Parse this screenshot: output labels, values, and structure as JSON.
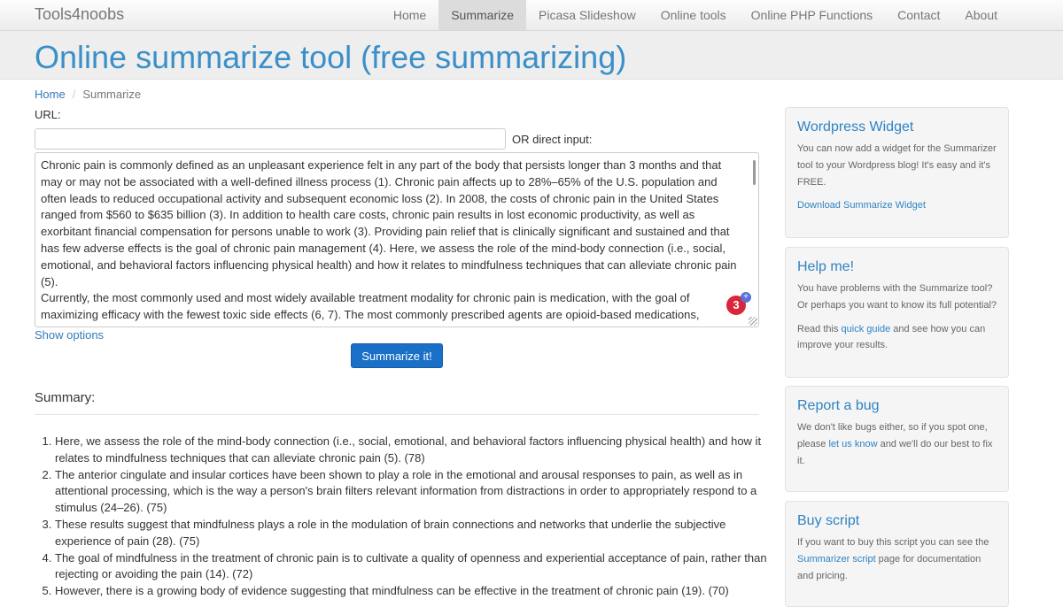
{
  "navbar": {
    "brand": "Tools4noobs",
    "items": [
      {
        "label": "Home",
        "active": false
      },
      {
        "label": "Summarize",
        "active": true
      },
      {
        "label": "Picasa Slideshow",
        "active": false
      },
      {
        "label": "Online tools",
        "active": false
      },
      {
        "label": "Online PHP Functions",
        "active": false
      },
      {
        "label": "Contact",
        "active": false
      },
      {
        "label": "About",
        "active": false
      }
    ]
  },
  "page_title": "Online summarize tool (free summarizing)",
  "breadcrumb": {
    "home": "Home",
    "separator": "/",
    "current": "Summarize"
  },
  "form": {
    "url_label": "URL:",
    "url_value": "",
    "or_label": "OR direct input:",
    "direct_input": "Chronic pain is commonly defined as an unpleasant experience felt in any part of the body that persists longer than 3 months and that may or may not be associated with a well-defined illness process (1). Chronic pain affects up to 28%–65% of the U.S. population and often leads to reduced occupational activity and subsequent economic loss (2). In 2008, the costs of chronic pain in the United States ranged from $560 to $635 billion (3). In addition to health care costs, chronic pain results in lost economic productivity, as well as exorbitant financial compensation for persons unable to work (3). Providing pain relief that is clinically significant and sustained and that has few adverse effects is the goal of chronic pain management (4). Here, we assess the role of the mind-body connection (i.e., social, emotional, and behavioral factors influencing physical health) and how it relates to mindfulness techniques that can alleviate chronic pain (5).\nCurrently, the most commonly used and most widely available treatment modality for chronic pain is medication, with the goal of maximizing efficacy with the fewest toxic side effects (6, 7). The most commonly prescribed agents are opioid-based medications,",
    "badge_count": "3",
    "badge_plus": "+",
    "show_options": "Show options",
    "submit_label": "Summarize it!"
  },
  "summary": {
    "heading": "Summary:",
    "items": [
      "Here, we assess the role of the mind-body connection (i.e., social, emotional, and behavioral factors influencing physical health) and how it relates to mindfulness techniques that can alleviate chronic pain (5). (78)",
      "The anterior cingulate and insular cortices have been shown to play a role in the emotional and arousal responses to pain, as well as in attentional processing, which is the way a person's brain filters relevant information from distractions in order to appropriately respond to a stimulus (24–26). (75)",
      "These results suggest that mindfulness plays a role in the modulation of brain connections and networks that underlie the subjective experience of pain (28). (75)",
      "The goal of mindfulness in the treatment of chronic pain is to cultivate a quality of openness and experiential acceptance of pain, rather than rejecting or avoiding the pain (14). (72)",
      "However, there is a growing body of evidence suggesting that mindfulness can be effective in the treatment of chronic pain (19). (70)"
    ]
  },
  "sidebar": {
    "widget": {
      "title": "Wordpress Widget",
      "text": "You can now add a widget for the Summarizer tool to your Wordpress blog! It's easy and it's FREE.",
      "link": "Download Summarize Widget"
    },
    "help": {
      "title": "Help me!",
      "text": "You have problems with the Summarize tool? Or perhaps you want to know its full potential?",
      "text2_pre": "Read this ",
      "link": "quick guide",
      "text2_post": " and see how you can improve your results."
    },
    "bug": {
      "title": "Report a bug",
      "text_pre": "We don't like bugs either, so if you spot one, please ",
      "link": "let us know",
      "text_post": " and we'll do our best to fix it."
    },
    "buy": {
      "title": "Buy script",
      "text_pre": "If you want to buy this script you can see the ",
      "link": "Summarizer script",
      "text_post": " page for documentation and pricing."
    }
  }
}
